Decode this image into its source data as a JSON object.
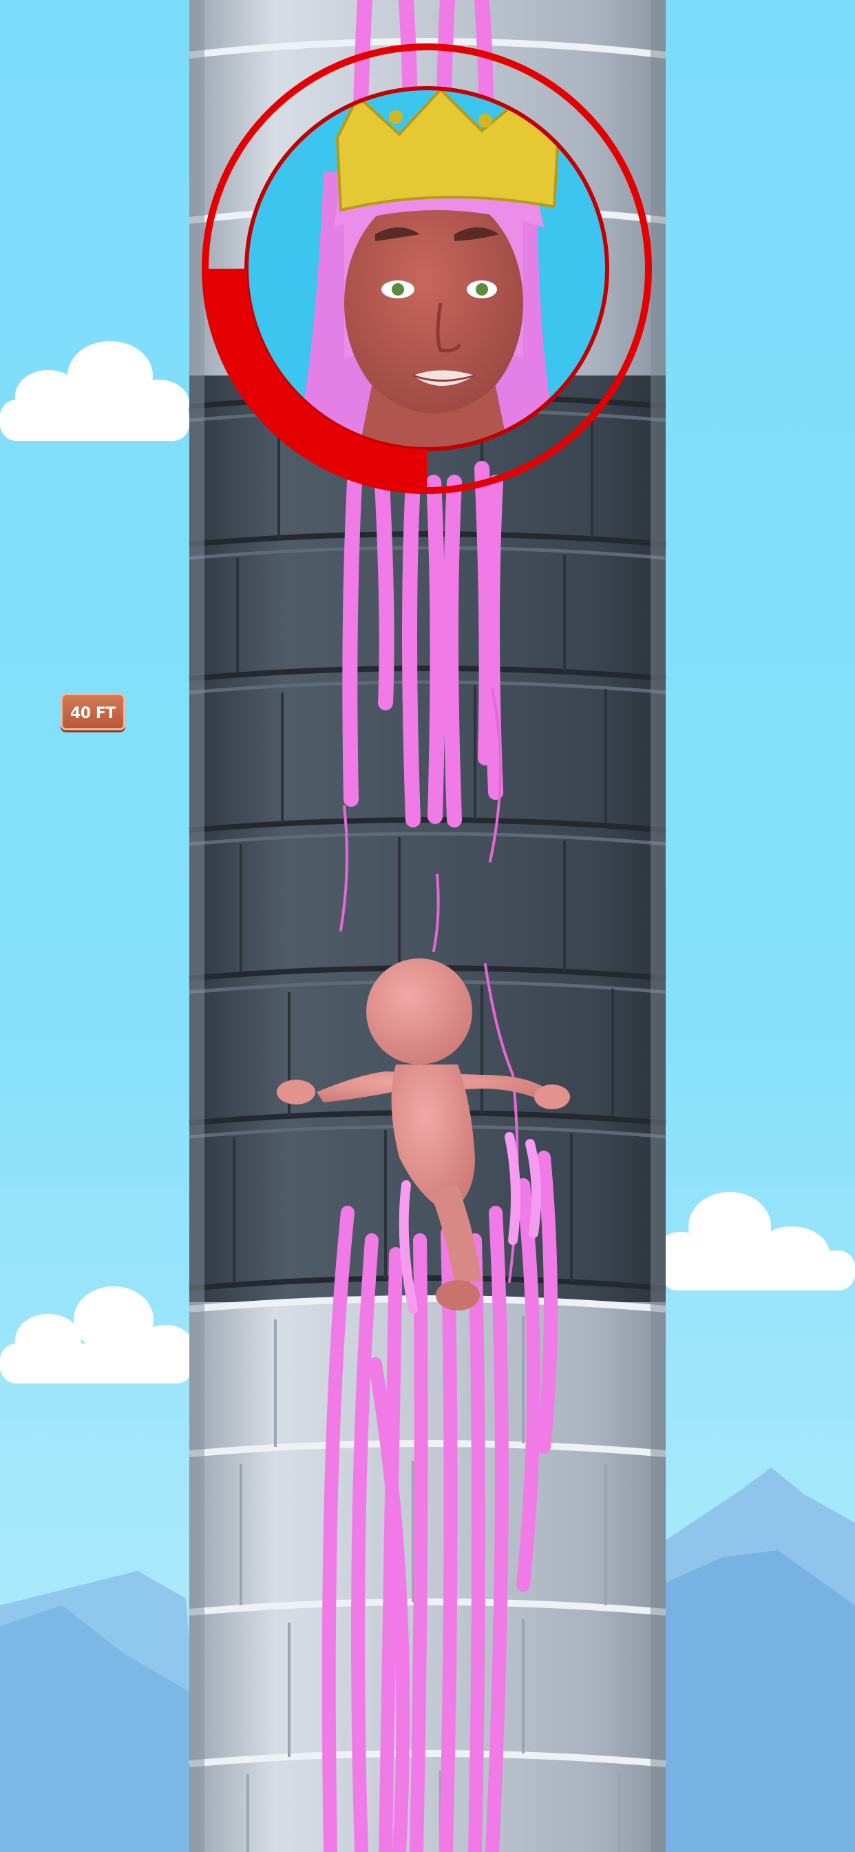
{
  "hud": {
    "height_label": "40 FT"
  },
  "princess_portrait": {
    "icon": "princess-icon",
    "timer_fill_fraction": 0.27
  },
  "colors": {
    "sky": "#7edcfb",
    "timer_ring": "#e40000",
    "hair": "#f27ae8",
    "tower_dark": "#4a5562",
    "tower_light": "#c5ccd6",
    "badge": "#c8694a"
  }
}
